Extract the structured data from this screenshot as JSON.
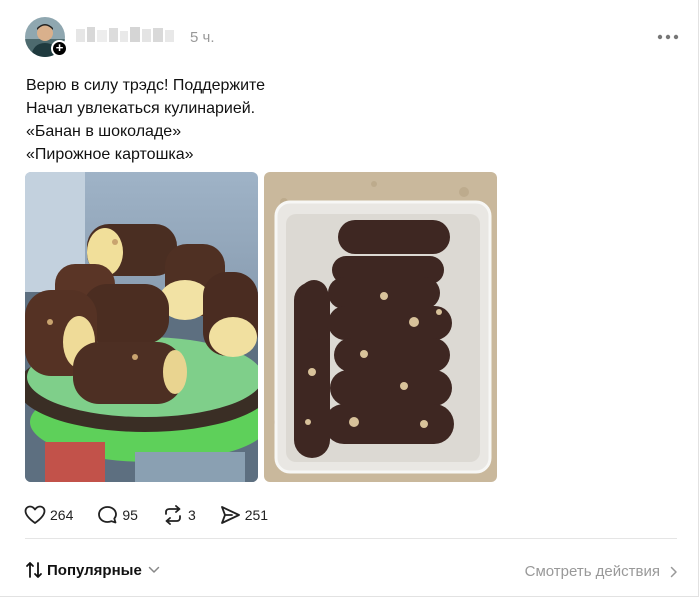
{
  "post": {
    "time": "5 ч.",
    "text_lines": [
      "Верю в силу трэдс! Поддержите",
      "Начал увлекаться кулинарией.",
      "«Банан в шоколаде»",
      "«Пирожное картошка»"
    ]
  },
  "actions": {
    "likes": "264",
    "comments": "95",
    "reposts": "3",
    "shares": "251"
  },
  "footer": {
    "sort_label": "Популярные",
    "view_actions": "Смотреть действия"
  },
  "icons": [
    "avatar-plus-icon",
    "more-icon",
    "heart-icon",
    "comment-icon",
    "repost-icon",
    "share-icon",
    "sort-icon",
    "chevron-down-icon",
    "chevron-right-icon"
  ]
}
